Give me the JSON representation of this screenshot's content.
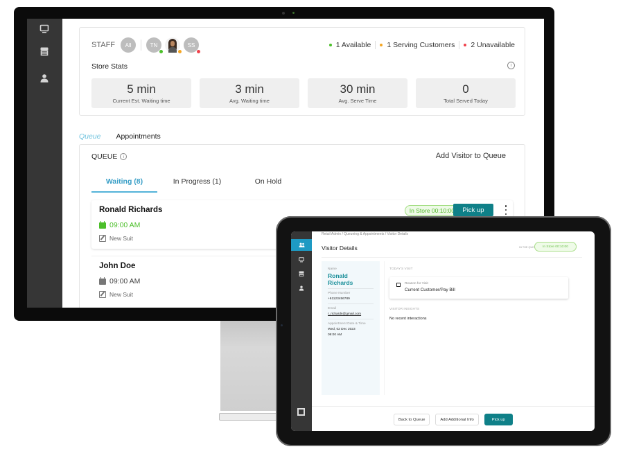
{
  "desktop": {
    "sidebar": {
      "items": [
        {
          "icon": "monitor-icon"
        },
        {
          "icon": "store-icon"
        },
        {
          "icon": "user-icon"
        }
      ]
    },
    "staff": {
      "label": "STAFF",
      "members": [
        {
          "initials": "All",
          "status": null
        },
        {
          "initials": "TN",
          "status": "available"
        },
        {
          "initials": "",
          "status": "serving",
          "photo": true
        },
        {
          "initials": "SS",
          "status": "unavailable"
        }
      ],
      "legend": [
        {
          "label": "1 Available",
          "color": "#4cc02a"
        },
        {
          "label": "1 Serving Customers",
          "color": "#f5a623"
        },
        {
          "label": "2 Unavailable",
          "color": "#f0414b"
        }
      ]
    },
    "store_stats": {
      "title": "Store Stats",
      "tiles": [
        {
          "value": "5 min",
          "label": "Current Est. Waiting time"
        },
        {
          "value": "3 min",
          "label": "Avg. Waiting time"
        },
        {
          "value": "30 min",
          "label": "Avg. Serve Time"
        },
        {
          "value": "0",
          "label": "Total Served Today"
        }
      ]
    },
    "main_tabs": [
      {
        "label": "Queue",
        "active": true
      },
      {
        "label": "Appointments",
        "active": false
      }
    ],
    "queue": {
      "title": "QUEUE",
      "add_visitor_label": "Add Visitor to Queue",
      "tabs": [
        {
          "label": "Waiting (8)",
          "active": true
        },
        {
          "label": "In Progress (1)",
          "active": false
        },
        {
          "label": "On Hold",
          "active": false
        }
      ],
      "visitors": [
        {
          "name": "Ronald Richards",
          "time": "09:00 AM",
          "reason": "New Suit",
          "in_store": "In Store 00:10:00",
          "pickup_label": "Pick up",
          "highlight": true
        },
        {
          "name": "John Doe",
          "time": "09:00 AM",
          "reason": "New Suit",
          "highlight": false
        }
      ]
    }
  },
  "tablet": {
    "sidebar": {
      "items": [
        {
          "icon": "people-icon",
          "active": true
        },
        {
          "icon": "monitor-icon",
          "active": false
        },
        {
          "icon": "store-icon",
          "active": false
        },
        {
          "icon": "user-icon",
          "active": false
        }
      ]
    },
    "breadcrumb": "Retail Admin  /  Queueing & Appointments  /  Visitor Details",
    "title": "Visitor Details",
    "queue_status_label": "IN THE QUEUE",
    "in_store": "In Store 00:10:00",
    "visitor": {
      "name_label": "Name",
      "name": "Ronald Richards",
      "phone_label": "Phone Number",
      "phone": "+61123456789",
      "email_label": "Email",
      "email": "r_richards@gmail.com",
      "appointment_label": "Appointment Date & Time",
      "appointment_date": "Wed, 02 Dec 2023",
      "appointment_time": "09:00 AM"
    },
    "todays_visit_label": "TODAY'S VISIT",
    "reason_label": "Reason for Visit",
    "reason_value": "Current Customer/Pay Bill",
    "insights_label": "VISITOR INSIGHTS",
    "insights_value": "No recent interactions",
    "footer": {
      "back_label": "Back to Queue",
      "add_info_label": "Add Additional Info",
      "pickup_label": "Pick up"
    }
  },
  "colors": {
    "accent_teal": "#0f8088",
    "active_blue": "#1e9ac3",
    "in_store_green": "#52b92b"
  }
}
